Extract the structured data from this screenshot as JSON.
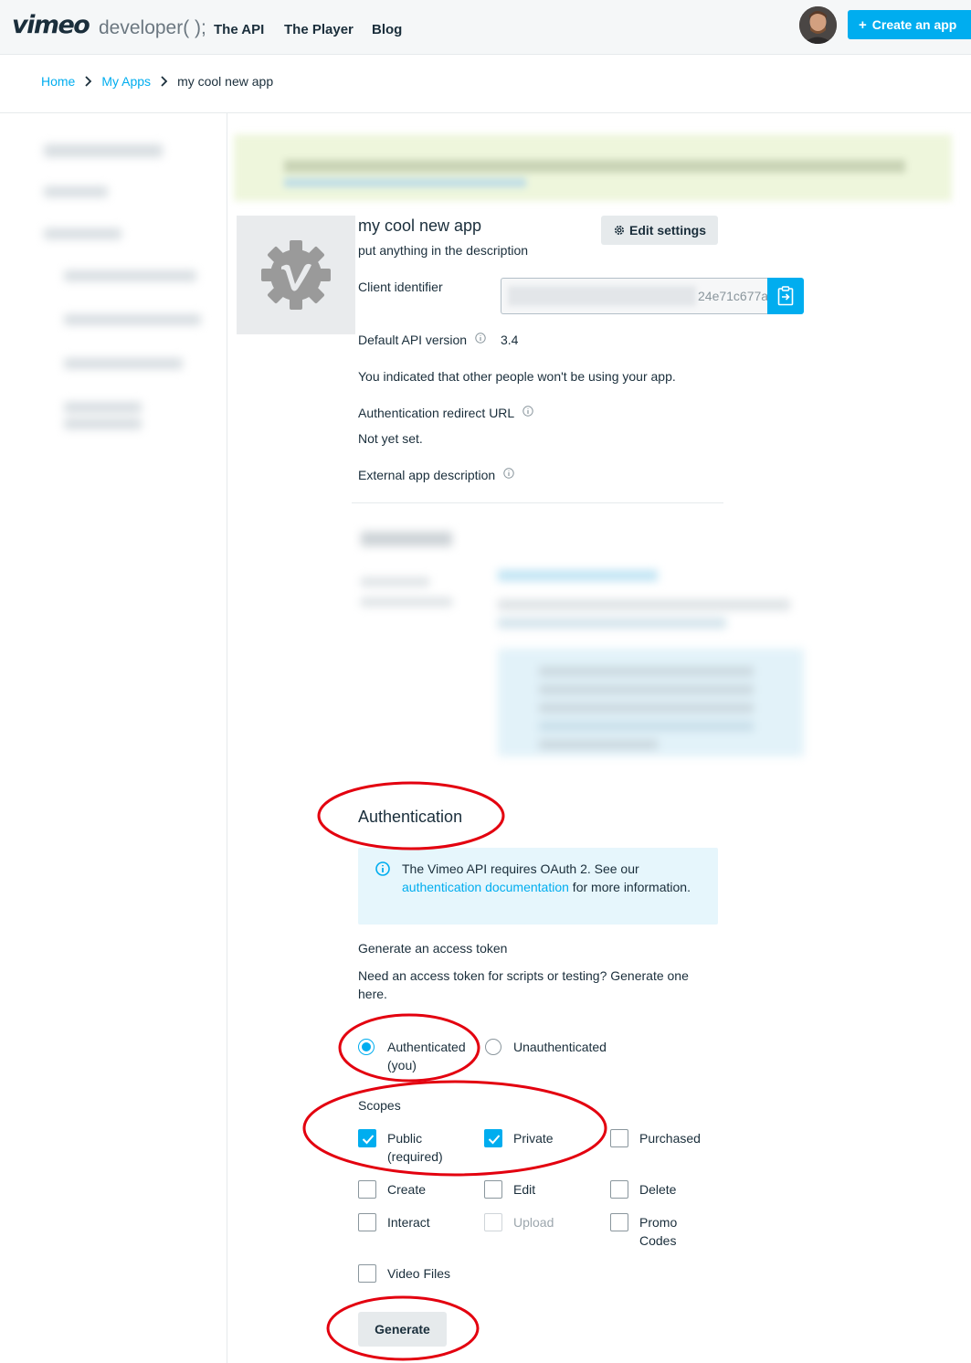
{
  "header": {
    "logo": "vimeo",
    "subtitle": "developer( );",
    "nav": [
      "The API",
      "The Player",
      "Blog"
    ],
    "create_label": "Create an app",
    "create_icon": "plus-icon"
  },
  "breadcrumb": {
    "home": "Home",
    "my_apps": "My Apps",
    "current": "my cool new app"
  },
  "app": {
    "name": "my cool new app",
    "description": "put anything in the description",
    "edit_label": "Edit settings",
    "client_label": "Client identifier",
    "client_value_visible": "24e71c677a",
    "api_version_label": "Default API version",
    "api_version": "3.4",
    "usage_note": "You indicated that other people won't be using your app.",
    "redirect_label": "Authentication redirect URL",
    "redirect_value": "Not yet set.",
    "external_label": "External app description"
  },
  "auth": {
    "title": "Authentication",
    "info_prefix": "The Vimeo API requires OAuth 2. See our ",
    "info_link": "authentication documentation",
    "info_suffix": " for more information.",
    "generate_label": "Generate an access token",
    "generate_help": "Need an access token for scripts or testing? Generate one here.",
    "radio_authenticated_1": "Authenticated",
    "radio_authenticated_2": "(you)",
    "radio_unauthenticated": "Unauthenticated",
    "scopes_label": "Scopes",
    "scope_public_1": "Public",
    "scope_public_2": "(required)",
    "scope_private": "Private",
    "scope_purchased": "Purchased",
    "scope_create": "Create",
    "scope_edit": "Edit",
    "scope_delete": "Delete",
    "scope_interact": "Interact",
    "scope_upload": "Upload",
    "scope_promo_1": "Promo",
    "scope_promo_2": "Codes",
    "scope_video_files": "Video Files",
    "generate_button": "Generate",
    "selected_radio": "Authenticated (you)",
    "checked_scopes": [
      "Public (required)",
      "Private"
    ],
    "disabled_scopes": [
      "Upload"
    ]
  },
  "colors": {
    "accent": "#00adef",
    "text": "#1a2e3b",
    "annotation": "#e3000f"
  }
}
